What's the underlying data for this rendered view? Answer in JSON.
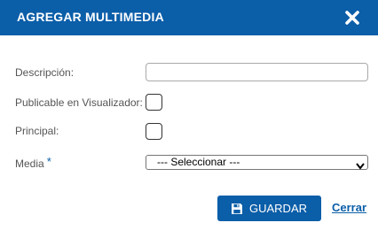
{
  "dialog": {
    "title": "AGREGAR MULTIMEDIA",
    "close_icon": "close-x-icon",
    "accent_color": "#0b5ea8"
  },
  "form": {
    "descripcion_label": "Descripción:",
    "descripcion_value": "",
    "publicable_label": "Publicable en Visualizador:",
    "publicable_checked": false,
    "principal_label": "Principal:",
    "principal_checked": false,
    "media_label": "Media",
    "media_required_mark": "*",
    "media_selected": "--- Seleccionar ---"
  },
  "actions": {
    "save_label": "GUARDAR",
    "save_icon": "floppy-disk-icon",
    "close_label": "Cerrar"
  }
}
